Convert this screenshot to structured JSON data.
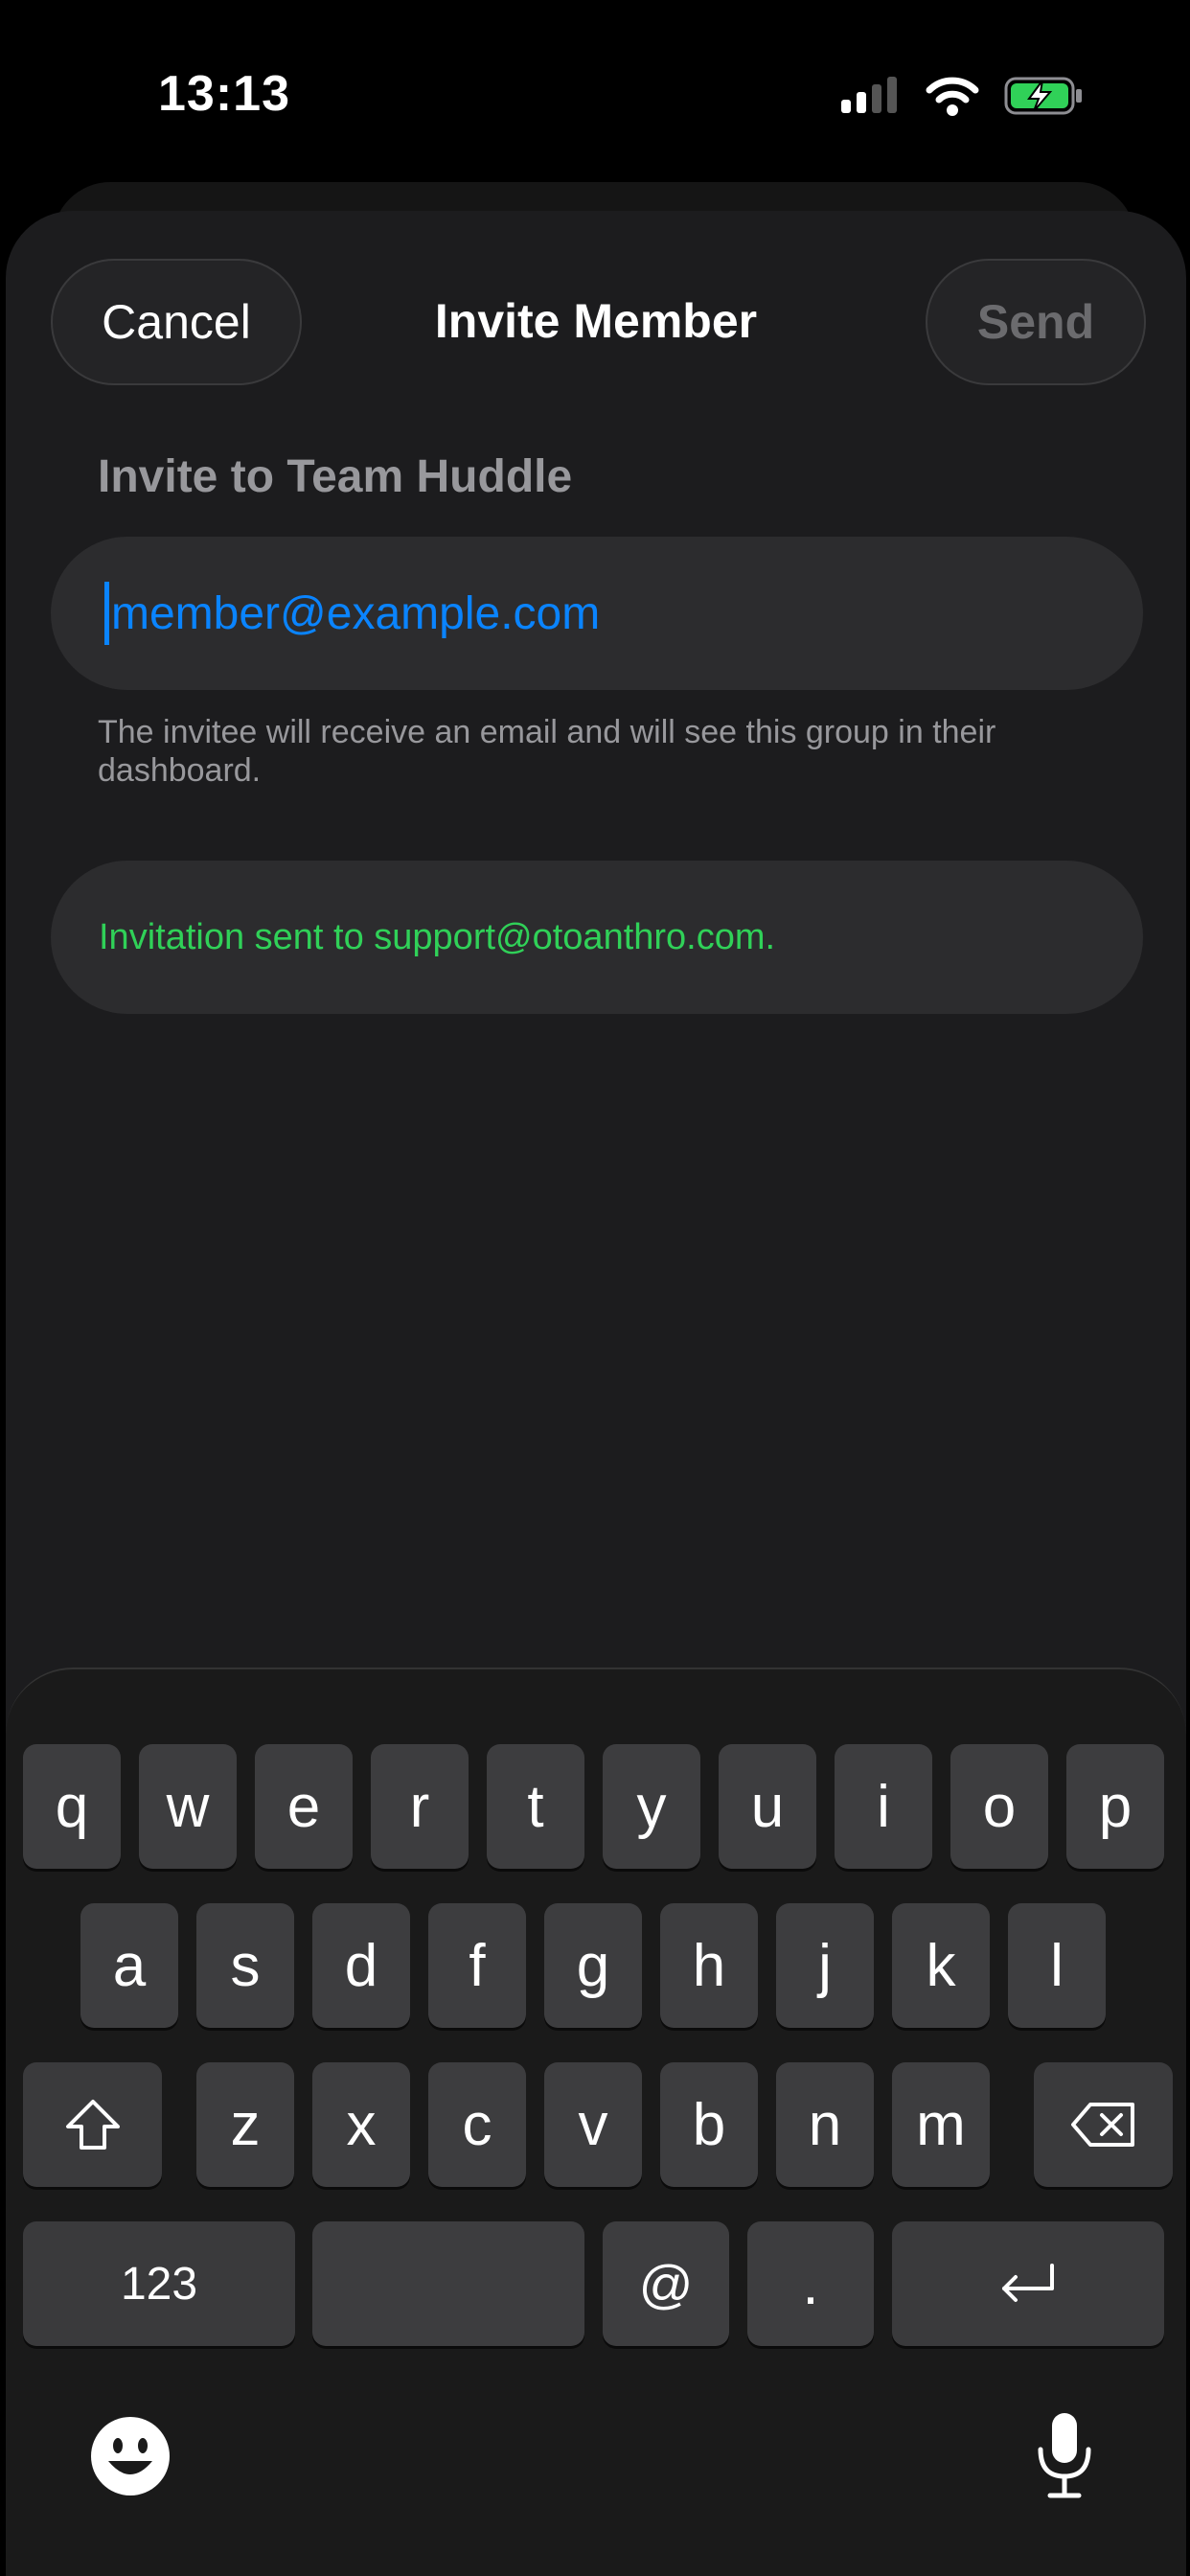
{
  "status_bar": {
    "time": "13:13"
  },
  "nav": {
    "cancel_label": "Cancel",
    "title": "Invite Member",
    "send_label": "Send"
  },
  "form": {
    "section_label": "Invite to Team Huddle",
    "email_placeholder": "member@example.com",
    "helper_text": "The invitee will receive an email and will see this group in their dashboard.",
    "success_message": "Invitation sent to support@otoanthro.com."
  },
  "keyboard": {
    "row1": [
      "q",
      "w",
      "e",
      "r",
      "t",
      "y",
      "u",
      "i",
      "o",
      "p"
    ],
    "row2": [
      "a",
      "s",
      "d",
      "f",
      "g",
      "h",
      "j",
      "k",
      "l"
    ],
    "row3": [
      "z",
      "x",
      "c",
      "v",
      "b",
      "n",
      "m"
    ],
    "numbers_label": "123",
    "at_label": "@",
    "dot_label": "."
  },
  "colors": {
    "accent": "#0a84ff",
    "success": "#30d158",
    "background": "#1c1c1e"
  }
}
